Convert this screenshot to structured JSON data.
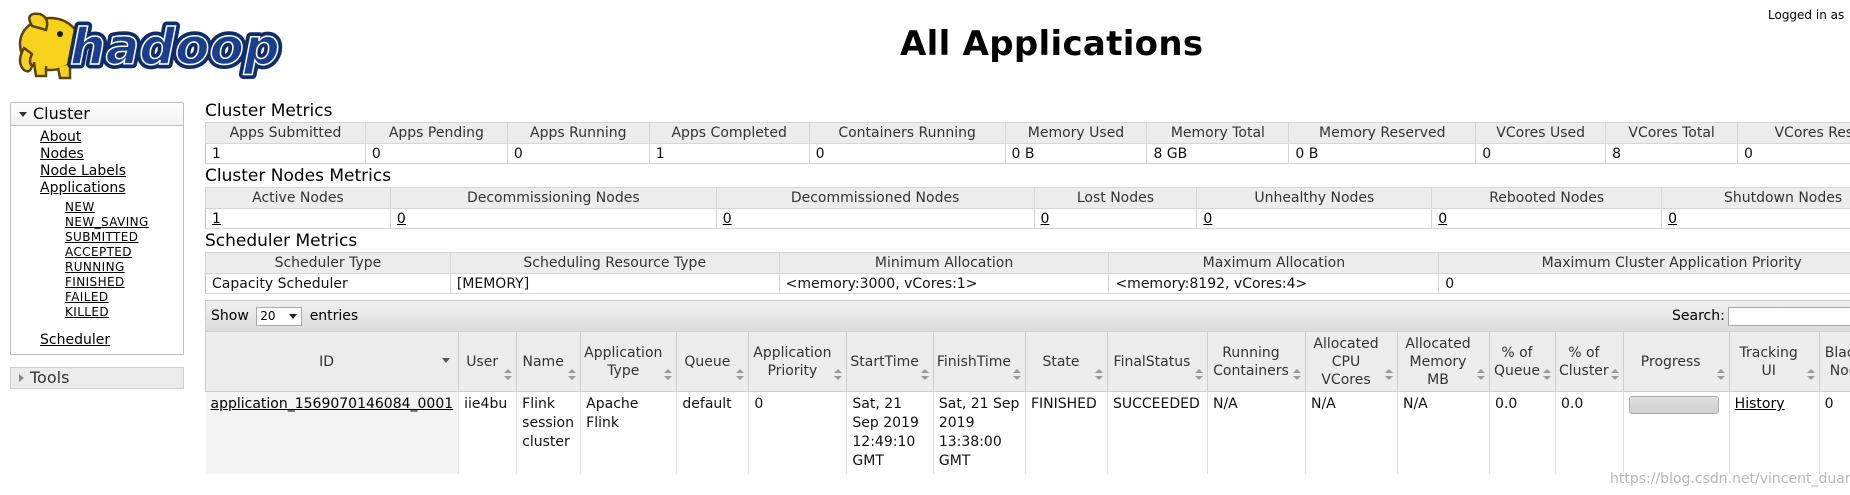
{
  "logo": {
    "text": "hadoop",
    "alt_name": "hadoop-elephant-logo"
  },
  "header": {
    "title": "All Applications",
    "logged_in": "Logged in as"
  },
  "sidebar": {
    "cluster": {
      "label": "Cluster",
      "links": [
        "About",
        "Nodes",
        "Node Labels",
        "Applications"
      ],
      "app_states": [
        "NEW",
        "NEW_SAVING",
        "SUBMITTED",
        "ACCEPTED",
        "RUNNING",
        "FINISHED",
        "FAILED",
        "KILLED"
      ],
      "scheduler": "Scheduler"
    },
    "tools": {
      "label": "Tools"
    }
  },
  "cluster_metrics": {
    "title": "Cluster Metrics",
    "headers": [
      "Apps Submitted",
      "Apps Pending",
      "Apps Running",
      "Apps Completed",
      "Containers Running",
      "Memory Used",
      "Memory Total",
      "Memory Reserved",
      "VCores Used",
      "VCores Total",
      "VCores Reser"
    ],
    "values": [
      "1",
      "0",
      "0",
      "1",
      "0",
      "0 B",
      "8 GB",
      "0 B",
      "0",
      "8",
      "0"
    ]
  },
  "cluster_nodes_metrics": {
    "title": "Cluster Nodes Metrics",
    "headers": [
      "Active Nodes",
      "Decommissioning Nodes",
      "Decommissioned Nodes",
      "Lost Nodes",
      "Unhealthy Nodes",
      "Rebooted Nodes",
      "Shutdown Nodes"
    ],
    "values": [
      "1",
      "0",
      "0",
      "0",
      "0",
      "0",
      "0"
    ]
  },
  "scheduler_metrics": {
    "title": "Scheduler Metrics",
    "headers": [
      "Scheduler Type",
      "Scheduling Resource Type",
      "Minimum Allocation",
      "Maximum Allocation",
      "Maximum Cluster Application Priority"
    ],
    "values": [
      "Capacity Scheduler",
      "[MEMORY]",
      "<memory:3000, vCores:1>",
      "<memory:8192, vCores:4>",
      "0"
    ]
  },
  "apps_table": {
    "show_label": "Show",
    "entries_value": "20",
    "entries_label": "entries",
    "search_label": "Search:",
    "headers": [
      "ID",
      "User",
      "Name",
      "Application Type",
      "Queue",
      "Application Priority",
      "StartTime",
      "FinishTime",
      "State",
      "FinalStatus",
      "Running Containers",
      "Allocated CPU VCores",
      "Allocated Memory MB",
      "% of Queue",
      "% of Cluster",
      "Progress",
      "Tracking UI",
      "Black Nod"
    ],
    "rows": [
      {
        "id": "application_1569070146084_0001",
        "user": "iie4bu",
        "name": "Flink session cluster",
        "type": "Apache Flink",
        "queue": "default",
        "priority": "0",
        "start": "Sat, 21 Sep 2019 12:49:10 GMT",
        "finish": "Sat, 21 Sep 2019 13:38:00 GMT",
        "state": "FINISHED",
        "final_status": "SUCCEEDED",
        "running_containers": "N/A",
        "cpu_vcores": "N/A",
        "memory_mb": "N/A",
        "pct_queue": "0.0",
        "pct_cluster": "0.0",
        "progress": 0,
        "tracking_ui": "History",
        "blacklisted": "0"
      }
    ]
  },
  "watermark": "https://blog.csdn.net/vincent_duan"
}
